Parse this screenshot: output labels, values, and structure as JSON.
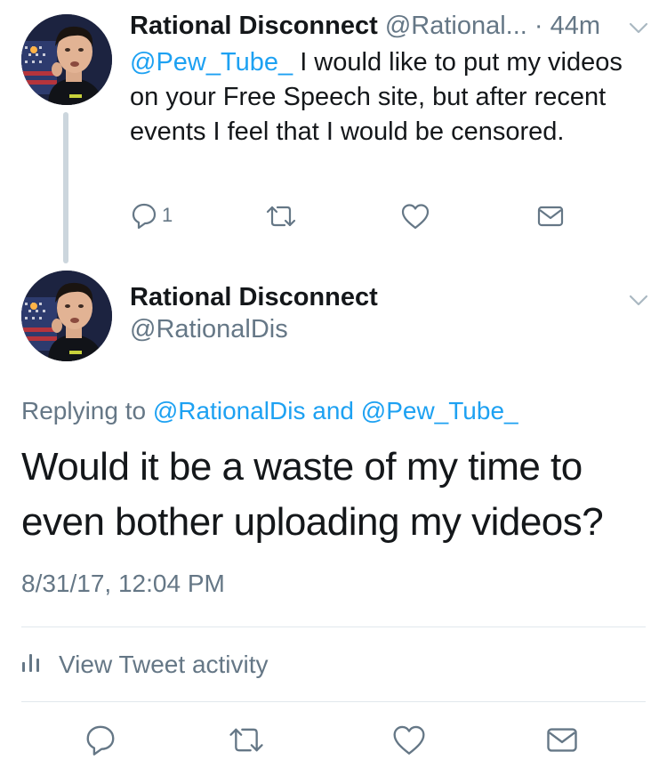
{
  "parent_tweet": {
    "display_name": "Rational Disconnect",
    "handle": "@Rational...",
    "separator": " · ",
    "time": "44m",
    "mention": "@Pew_Tube_",
    "text": " I would like to put my videos on your Free Speech site, but after recent events I feel that I would be censored.",
    "reply_count": "1",
    "icons": [
      "reply-icon",
      "retweet-icon",
      "like-icon",
      "direct-message-icon",
      "chevron-down-icon"
    ]
  },
  "main_tweet": {
    "display_name": "Rational Disconnect",
    "handle": "@RationalDis",
    "replying_prefix": "Replying to ",
    "replying_user1": "@RationalDis",
    "replying_and": " and ",
    "replying_user2": "@Pew_Tube_",
    "text": "Would it be a waste of my time to even bother uploading my videos?",
    "timestamp": "8/31/17, 12:04 PM",
    "view_activity_label": "View Tweet activity",
    "icons": [
      "activity-bars-icon",
      "reply-icon",
      "retweet-icon",
      "like-icon",
      "direct-message-icon",
      "chevron-down-icon"
    ]
  },
  "colors": {
    "link_blue": "#1da1f2",
    "text_dark": "#14171a",
    "text_gray": "#657786",
    "icon_gray": "#657786",
    "divider": "#e1e8ed",
    "thread_line": "#ccd6dd"
  }
}
